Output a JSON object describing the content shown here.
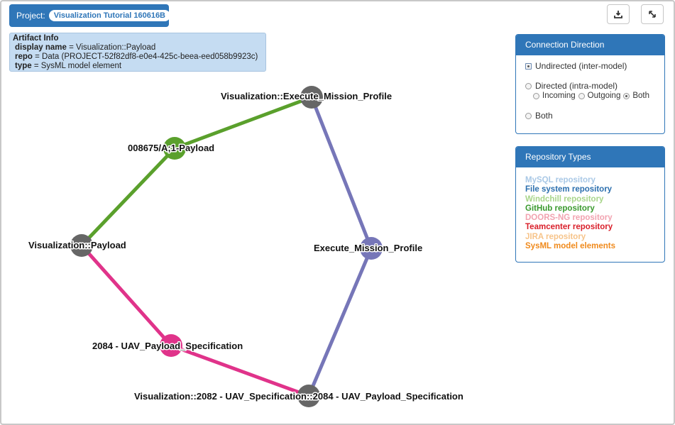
{
  "project": {
    "label": "Project:",
    "name": "Visualization Tutorial 160616B"
  },
  "toolbar": {
    "download_icon": "download-icon",
    "expand_icon": "expand-icon"
  },
  "artifact_info": {
    "title": "Artifact Info",
    "fields": [
      {
        "key": "display name",
        "value": "Visualization::Payload"
      },
      {
        "key": "repo",
        "value": "Data (PROJECT-52f82df8-e0e4-425c-beea-eed058b9923c)"
      },
      {
        "key": "type",
        "value": "SysML model element"
      }
    ]
  },
  "connection_direction": {
    "title": "Connection Direction",
    "undirected": "Undirected (inter-model)",
    "directed": "Directed (intra-model)",
    "incoming": "Incoming",
    "outgoing": "Outgoing",
    "both_sub": "Both",
    "both": "Both",
    "selected": "undirected"
  },
  "repository_types": {
    "title": "Repository Types",
    "items": [
      {
        "label": "MySQL repository",
        "color": "#a9c8e6"
      },
      {
        "label": "File system repository",
        "color": "#2c6fae"
      },
      {
        "label": "Windchill repository",
        "color": "#a8d58a"
      },
      {
        "label": "GitHub repository",
        "color": "#3a9a2e"
      },
      {
        "label": "DOORS-NG repository",
        "color": "#f2a3b0"
      },
      {
        "label": "Teamcenter repository",
        "color": "#d91f2a"
      },
      {
        "label": "JIRA repository",
        "color": "#f7c48a"
      },
      {
        "label": "SysML model elements",
        "color": "#f08a1c"
      }
    ]
  },
  "graph": {
    "nodes": [
      {
        "id": "n1",
        "label": "Visualization::Execute_Mission_Profile",
        "color": "#666666"
      },
      {
        "id": "n2",
        "label": "008675/A;1-Payload",
        "color": "#5aa02c"
      },
      {
        "id": "n3",
        "label": "Visualization::Payload",
        "color": "#666666"
      },
      {
        "id": "n4",
        "label": "Execute_Mission_Profile",
        "color": "#7676b8"
      },
      {
        "id": "n5",
        "label": "2084 - UAV_Payload_Specification",
        "color": "#e0338a"
      },
      {
        "id": "n6",
        "label": "Visualization::2082 - UAV_Specification::2084 - UAV_Payload_Specification",
        "color": "#666666"
      }
    ],
    "edges": [
      {
        "from": "n1",
        "to": "n2",
        "color": "#5aa02c"
      },
      {
        "from": "n2",
        "to": "n3",
        "color": "#5aa02c"
      },
      {
        "from": "n1",
        "to": "n4",
        "color": "#7676b8"
      },
      {
        "from": "n4",
        "to": "n6",
        "color": "#7676b8"
      },
      {
        "from": "n3",
        "to": "n5",
        "color": "#e0338a"
      },
      {
        "from": "n5",
        "to": "n6",
        "color": "#e0338a"
      }
    ]
  }
}
